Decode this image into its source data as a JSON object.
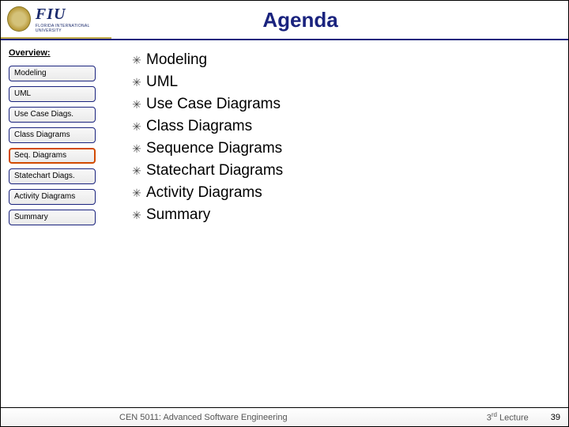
{
  "header": {
    "logo_text": "FIU",
    "logo_sub": "FLORIDA INTERNATIONAL UNIVERSITY",
    "title": "Agenda"
  },
  "sidebar": {
    "label": "Overview:",
    "items": [
      {
        "label": "Modeling",
        "active": false
      },
      {
        "label": "UML",
        "active": false
      },
      {
        "label": "Use Case Diags.",
        "active": false
      },
      {
        "label": "Class Diagrams",
        "active": false
      },
      {
        "label": "Seq. Diagrams",
        "active": true
      },
      {
        "label": "Statechart Diags.",
        "active": false
      },
      {
        "label": "Activity Diagrams",
        "active": false
      },
      {
        "label": "Summary",
        "active": false
      }
    ]
  },
  "content": {
    "bullets": [
      "Modeling",
      "UML",
      "Use Case Diagrams",
      "Class Diagrams",
      "Sequence Diagrams",
      "Statechart Diagrams",
      "Activity Diagrams",
      "Summary"
    ]
  },
  "footer": {
    "course": "CEN 5011: Advanced Software Engineering",
    "lecture_ordinal": "3",
    "lecture_suffix": "rd",
    "lecture_word": " Lecture",
    "page": "39"
  }
}
